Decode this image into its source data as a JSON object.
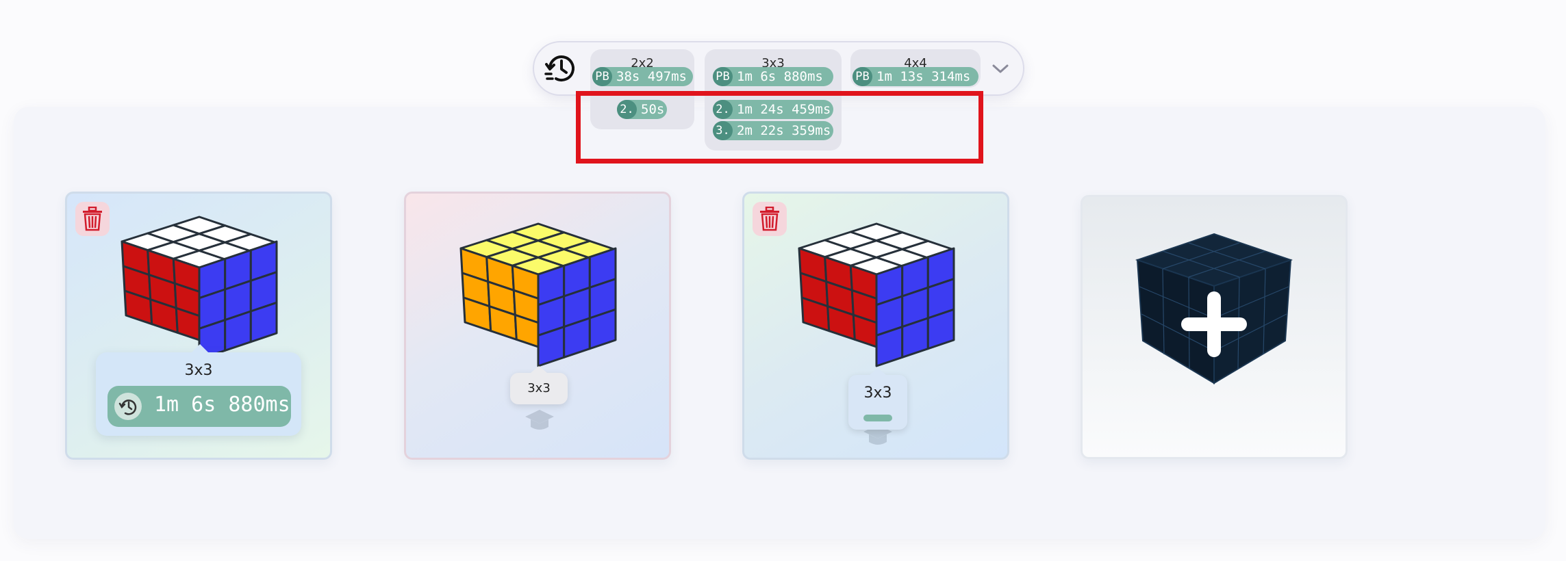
{
  "history": {
    "icon": "history-icon",
    "dropdown_icon": "chevron-down-icon",
    "columns": [
      {
        "title": "2x2",
        "pb_tag": "PB",
        "pb": "38s 497ms",
        "entries": [
          {
            "rank": "2.",
            "time": "50s"
          }
        ]
      },
      {
        "title": "3x3",
        "pb_tag": "PB",
        "pb": "1m 6s 880ms",
        "entries": [
          {
            "rank": "2.",
            "time": "1m 24s 459ms"
          },
          {
            "rank": "3.",
            "time": "2m 22s 359ms"
          }
        ]
      },
      {
        "title": "4x4",
        "pb_tag": "PB",
        "pb": "1m 13s 314ms",
        "entries": []
      }
    ]
  },
  "cards": [
    {
      "name": "3x3",
      "time": "1m 6s 880ms",
      "deletable": true,
      "top_color": "#ffffff",
      "left_color": "#cc1111",
      "right_color": "#3c3cf2"
    },
    {
      "name": "3x3",
      "deletable": false,
      "top_color": "#fbfb6a",
      "left_color": "#ffa500",
      "right_color": "#3c3cf2",
      "icon": "graduation-cap-icon"
    },
    {
      "name": "3x3",
      "deletable": true,
      "top_color": "#ffffff",
      "left_color": "#cc1111",
      "right_color": "#3c3cf2",
      "icon": "graduation-cap-icon"
    },
    {
      "name": "",
      "add_icon": "plus-icon",
      "cube_color": "#0e1d2e"
    }
  ],
  "colors": {
    "accent": "#7fb8a8",
    "accent_dark": "#4c8f80",
    "highlight": "#e0141c"
  }
}
